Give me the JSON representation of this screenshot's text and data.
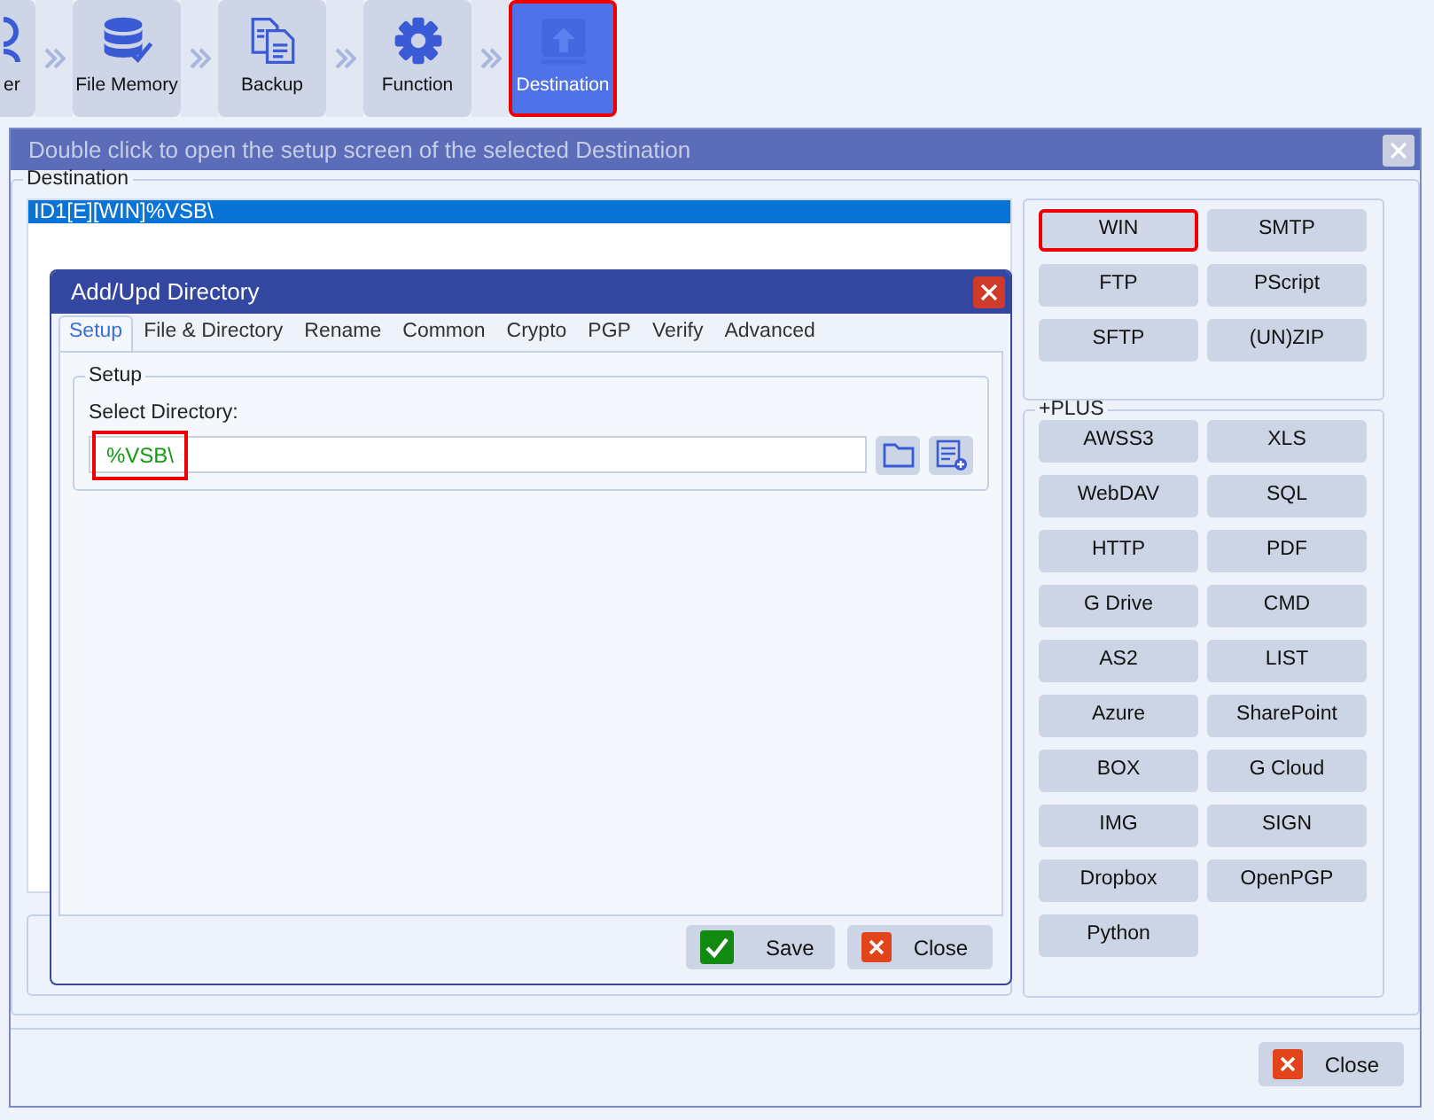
{
  "toolbar": [
    {
      "label": "er",
      "selected": false
    },
    {
      "label": "File Memory",
      "selected": false
    },
    {
      "label": "Backup",
      "selected": false
    },
    {
      "label": "Function",
      "selected": false
    },
    {
      "label": "Destination",
      "selected": true
    }
  ],
  "main_window": {
    "title": "Double click to open the setup screen of the selected Destination",
    "group_title": "Destination",
    "list": [
      {
        "text": "ID1[E][WIN]%VSB\\",
        "selected": true
      }
    ],
    "types": [
      {
        "label": "WIN",
        "selected": true
      },
      {
        "label": "SMTP",
        "selected": false
      },
      {
        "label": "FTP",
        "selected": false
      },
      {
        "label": "PScript",
        "selected": false
      },
      {
        "label": "SFTP",
        "selected": false
      },
      {
        "label": "(UN)ZIP",
        "selected": false
      }
    ],
    "plus_title": "+PLUS",
    "plus": [
      "AWSS3",
      "XLS",
      "WebDAV",
      "SQL",
      "HTTP",
      "PDF",
      "G Drive",
      "CMD",
      "AS2",
      "LIST",
      "Azure",
      "SharePoint",
      "BOX",
      "G Cloud",
      "IMG",
      "SIGN",
      "Dropbox",
      "OpenPGP",
      "Python"
    ],
    "close_button": "Close"
  },
  "dialog": {
    "title": "Add/Upd Directory",
    "tabs": [
      {
        "label": "Setup",
        "selected": true
      },
      {
        "label": "File & Directory",
        "selected": false
      },
      {
        "label": "Rename",
        "selected": false
      },
      {
        "label": "Common",
        "selected": false
      },
      {
        "label": "Crypto",
        "selected": false
      },
      {
        "label": "PGP",
        "selected": false
      },
      {
        "label": "Verify",
        "selected": false
      },
      {
        "label": "Advanced",
        "selected": false
      }
    ],
    "group_title": "Setup",
    "field_label": "Select Directory:",
    "directory": {
      "value": "%VSB\\",
      "highlighted": true
    },
    "save_button": "Save",
    "close_button": "Close"
  }
}
